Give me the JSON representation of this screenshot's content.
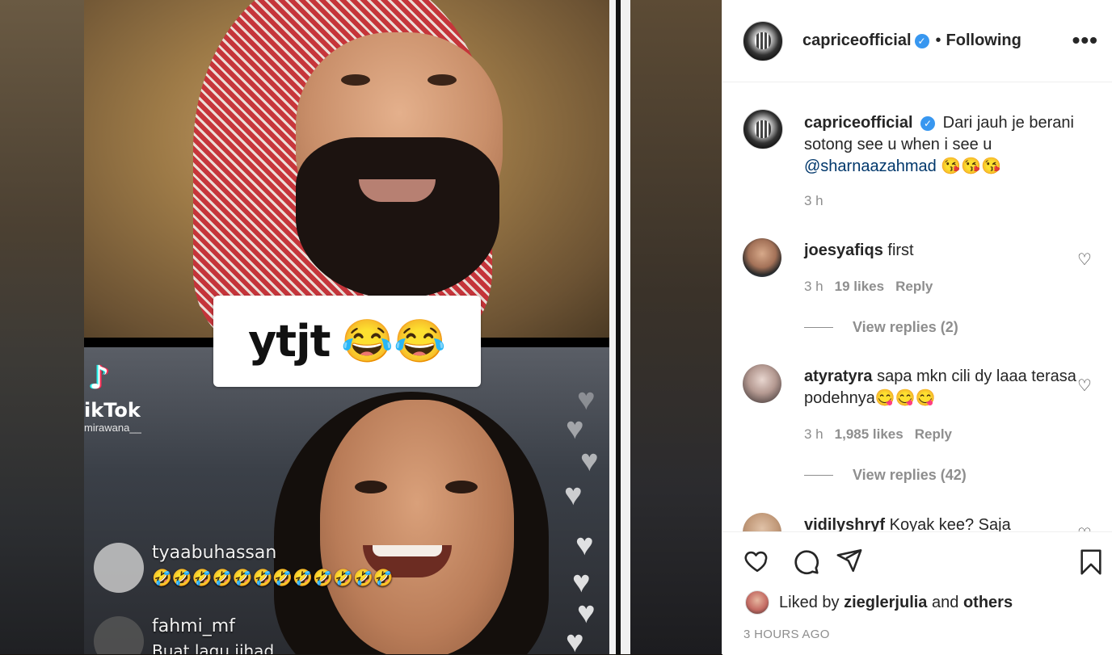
{
  "media": {
    "caption_text": "ytjt",
    "caption_emoji": "😂😂",
    "tiktok_brand": "ikTok",
    "tiktok_handle": "mirawana__",
    "live_comments": [
      {
        "username": "tyaabuhassan",
        "text": "🤣🤣🤣🤣🤣🤣🤣🤣🤣🤣🤣🤣"
      },
      {
        "username": "fahmi_mf",
        "text": "Buat lagu jihad"
      }
    ]
  },
  "header": {
    "username": "capriceofficial",
    "separator": "•",
    "follow_status": "Following",
    "more_label": "•••"
  },
  "caption": {
    "username": "capriceofficial",
    "text": "Dari jauh je berani sotong see u when i see u",
    "mention": "@sharnaazahmad",
    "emoji": "😘😘😘",
    "time": "3 h"
  },
  "comments": [
    {
      "username": "joesyafiqs",
      "text": "first",
      "time": "3 h",
      "likes": "19 likes",
      "reply": "Reply",
      "view_replies": "View replies (2)"
    },
    {
      "username": "atyratyra",
      "text": "sapa mkn cili dy laaa terasa podehnya😋😋😋",
      "time": "3 h",
      "likes": "1,985 likes",
      "reply": "Reply",
      "view_replies": "View replies (42)"
    },
    {
      "username": "vidilyshryf",
      "text": "Koyak kee? Saja"
    }
  ],
  "footer": {
    "liked_prefix": "Liked by",
    "liked_user": "zieglerjulia",
    "liked_and": "and",
    "liked_others": "others",
    "timestamp": "3 HOURS AGO"
  },
  "icons": [
    "heart-icon",
    "comment-icon",
    "share-icon",
    "bookmark-icon",
    "verified-badge-icon",
    "more-options-icon"
  ]
}
